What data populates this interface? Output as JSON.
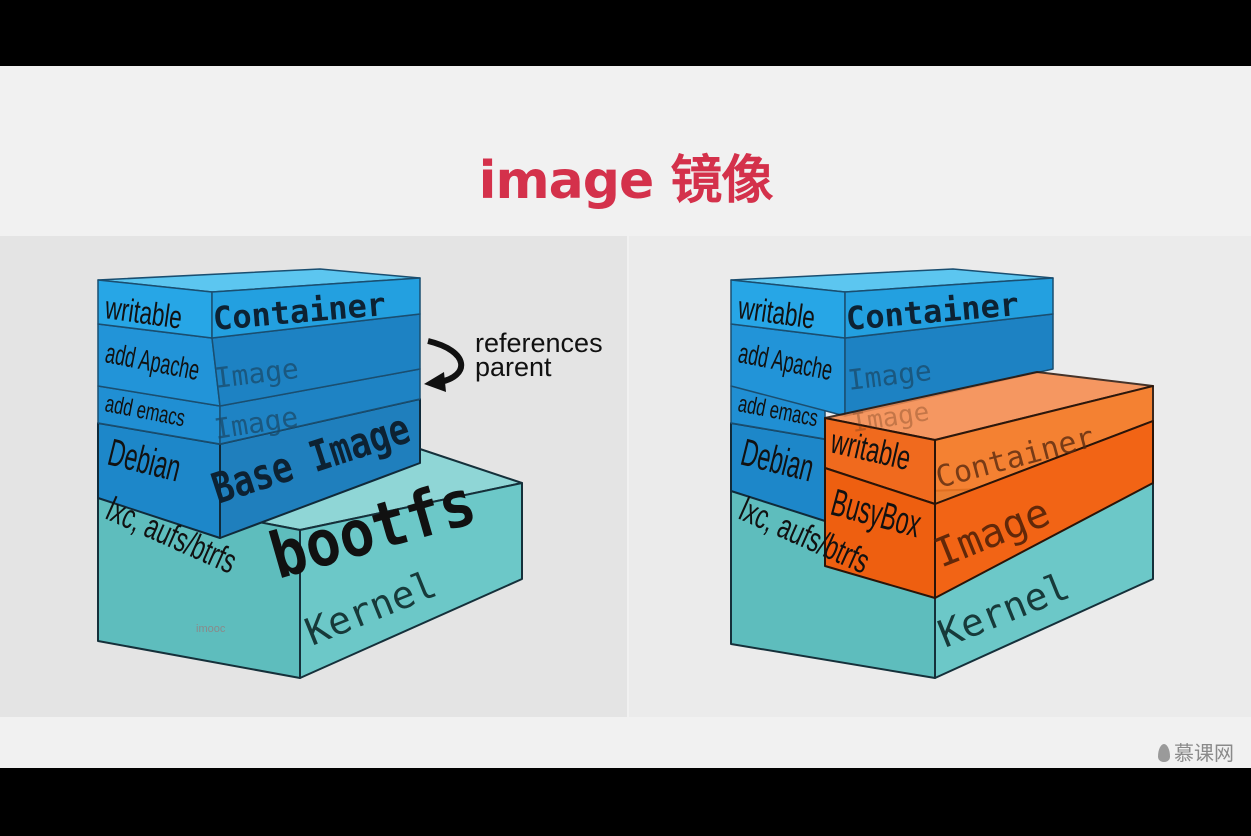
{
  "title": "image 镜像",
  "colors": {
    "title": "#d4314b",
    "blue_light": "#22a2e0",
    "blue_mid": "#1f86c6",
    "teal": "#5fc3c3",
    "orange": "#f26419"
  },
  "left_diagram": {
    "side_labels": {
      "writable": "writable",
      "apache": "add Apache",
      "emacs": "add emacs",
      "debian": "Debian",
      "lxc": "lxc, aufs/btrfs"
    },
    "front_labels": {
      "container": "Container",
      "image1": "Image",
      "image2": "Image",
      "base": "Base Image",
      "bootfs": "bootfs",
      "kernel": "Kernel"
    },
    "annotation": [
      "references",
      "parent"
    ],
    "watermark": "imooc"
  },
  "right_diagram": {
    "side_labels": {
      "writable": "writable",
      "apache": "add Apache",
      "emacs": "add emacs",
      "debian": "Debian",
      "lxc": "lxc, aufs/btrfs",
      "writable2": "writable",
      "busybox": "BusyBox"
    },
    "front_labels": {
      "container": "Container",
      "image1": "Image",
      "image_ghost": "Image",
      "container2": "Container",
      "image_busybox": "Image",
      "kernel": "Kernel"
    }
  },
  "logo": "慕课网"
}
